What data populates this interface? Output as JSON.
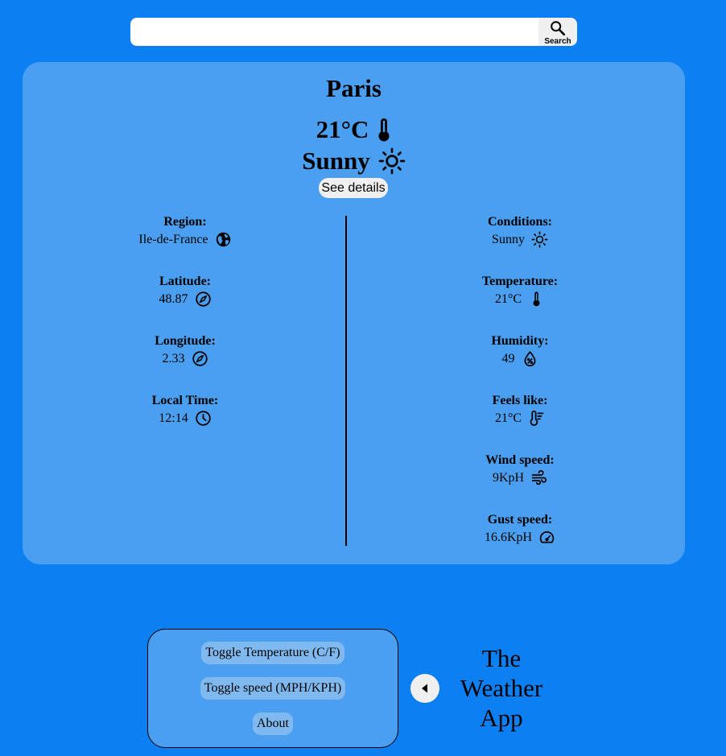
{
  "search": {
    "value": "",
    "placeholder": "",
    "button_label": "Search"
  },
  "current": {
    "city": "Paris",
    "temp": "21°C",
    "condition": "Sunny",
    "details_label": "See details"
  },
  "details_left": [
    {
      "label": "Region:",
      "value": "Ile-de-France",
      "icon": "globe-icon"
    },
    {
      "label": "Latitude:",
      "value": "48.87",
      "icon": "compass-icon"
    },
    {
      "label": "Longitude:",
      "value": "2.33",
      "icon": "compass-icon"
    },
    {
      "label": "Local Time:",
      "value": "12:14",
      "icon": "clock-icon"
    }
  ],
  "details_right": [
    {
      "label": "Conditions:",
      "value": "Sunny",
      "icon": "sun-icon"
    },
    {
      "label": "Temperature:",
      "value": "21°C",
      "icon": "thermometer-icon"
    },
    {
      "label": "Humidity:",
      "value": "49",
      "icon": "humidity-icon"
    },
    {
      "label": "Feels like:",
      "value": "21°C",
      "icon": "thermometer-low-icon"
    },
    {
      "label": "Wind speed:",
      "value": "9KpH",
      "icon": "wind-icon"
    },
    {
      "label": "Gust speed:",
      "value": "16.6KpH",
      "icon": "gauge-icon"
    }
  ],
  "menu": {
    "toggle_temp_label": "Toggle Temperature (C/F)",
    "toggle_speed_label": "Toggle speed (MPH/KPH)",
    "about_label": "About"
  },
  "app": {
    "title": "The Weather App"
  },
  "colors": {
    "background": "#0c7ff2",
    "card": "#4b9ff1",
    "button": "#f0f0f0"
  }
}
